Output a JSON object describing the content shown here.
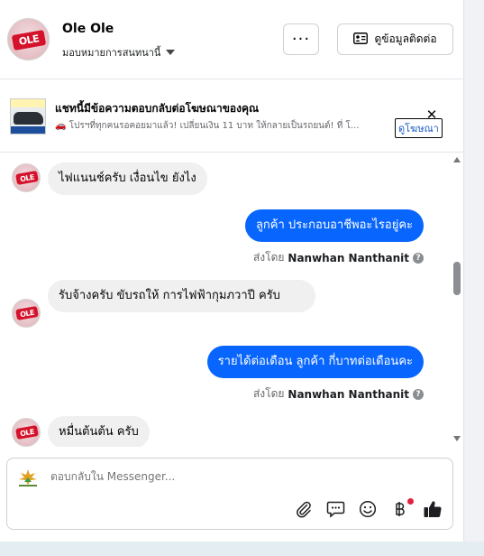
{
  "header": {
    "name": "Ole Ole",
    "assign_label": "มอบหมายการสนทนานี้",
    "more_label": "···",
    "contact_label": "ดูข้อมูลติดต่อ"
  },
  "ad": {
    "title": "แชทนี้มีข้อความตอบกลับต่อโฆษณาของคุณ",
    "text": "🚗 โปรฯที่ทุกคนรอคอยมาแล้ว! เปลี่ยนเงิน 11 บาท ให้กลายเป็นรถยนต์! ที่ โ...",
    "link_label": "ดูโฆษณา",
    "close_label": "✕"
  },
  "avatar_text": "OLE",
  "messages": [
    {
      "dir": "in",
      "text": "ไฟแนนช์ครับ เงื่อนไข ยังไง"
    },
    {
      "dir": "out",
      "text": "ลูกค้า ประกอบอาชีพอะไรอยู่คะ",
      "sent_prefix": "ส่งโดย",
      "sender": "Nanwhan Nanthanit"
    },
    {
      "dir": "in",
      "text": "รับจ้างครับ ขับรถให้ การไฟฟ้ากุมภวาปี ครับ"
    },
    {
      "dir": "out",
      "text": "รายได้ต่อเดือน  ลูกค้า  กี่บาทต่อเดือนคะ",
      "sent_prefix": "ส่งโดย",
      "sender": "Nanwhan Nanthanit"
    },
    {
      "dir": "in",
      "text": "หมื่นต้นต้น ครับ"
    }
  ],
  "composer": {
    "placeholder": "ตอบกลับใน Messenger..."
  },
  "colors": {
    "accent": "#0866ff",
    "bubble_in": "#f0f0f0",
    "badge": "#d4122b",
    "notification_dot": "#e41e3f"
  },
  "icons": [
    "ellipsis-icon",
    "contact-card-icon",
    "close-icon",
    "chevron-down-icon",
    "attachment-icon",
    "saved-reply-icon",
    "emoji-icon",
    "baht-icon",
    "thumbs-up-icon"
  ]
}
